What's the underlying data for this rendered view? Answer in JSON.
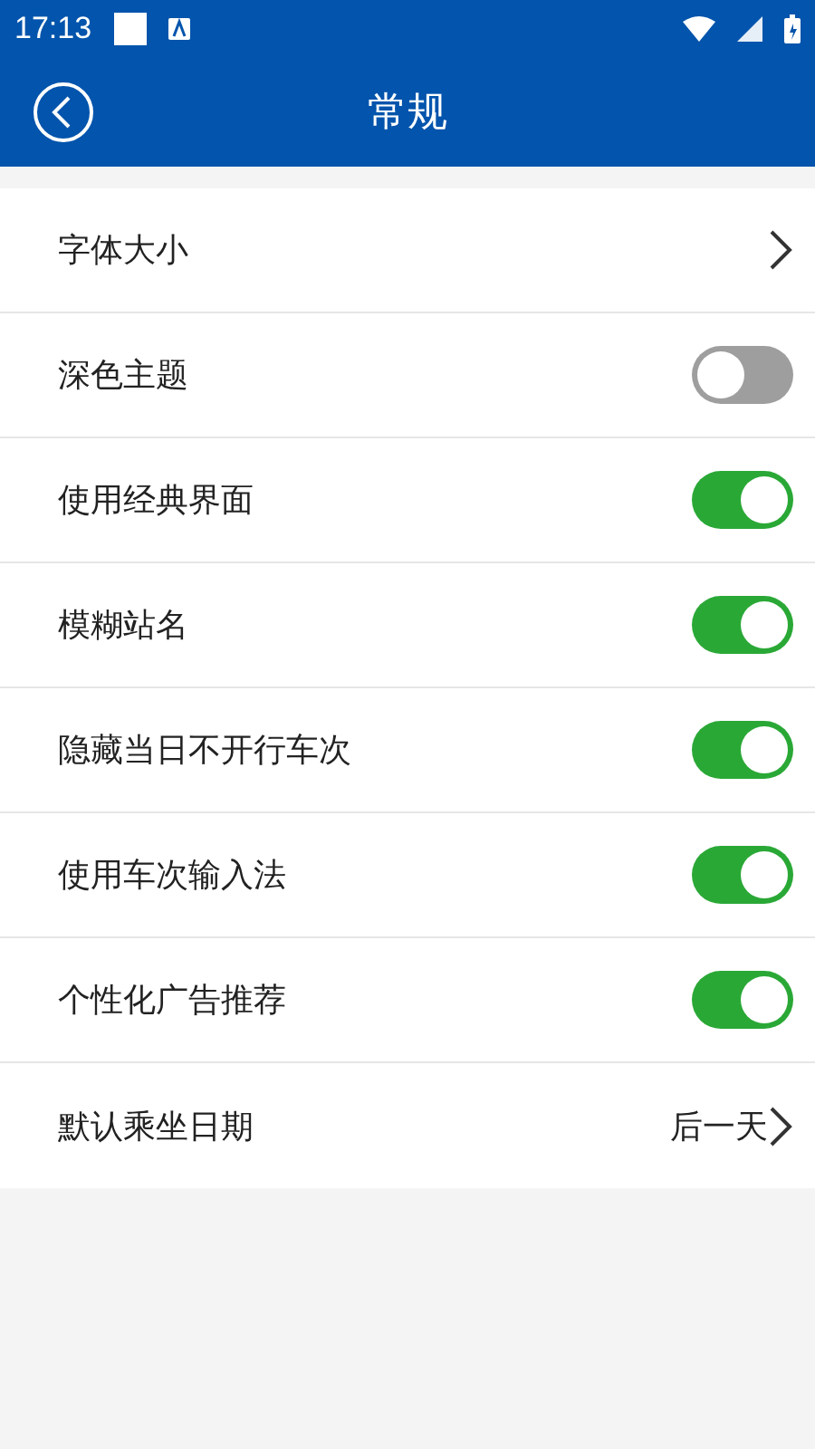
{
  "status_bar": {
    "time": "17:13"
  },
  "header": {
    "title": "常规"
  },
  "settings": [
    {
      "kind": "link",
      "label": "字体大小"
    },
    {
      "kind": "toggle",
      "label": "深色主题",
      "on": false
    },
    {
      "kind": "toggle",
      "label": "使用经典界面",
      "on": true
    },
    {
      "kind": "toggle",
      "label": "模糊站名",
      "on": true
    },
    {
      "kind": "toggle",
      "label": "隐藏当日不开行车次",
      "on": true
    },
    {
      "kind": "toggle",
      "label": "使用车次输入法",
      "on": true
    },
    {
      "kind": "toggle",
      "label": "个性化广告推荐",
      "on": true
    },
    {
      "kind": "value",
      "label": "默认乘坐日期",
      "value": "后一天"
    }
  ]
}
